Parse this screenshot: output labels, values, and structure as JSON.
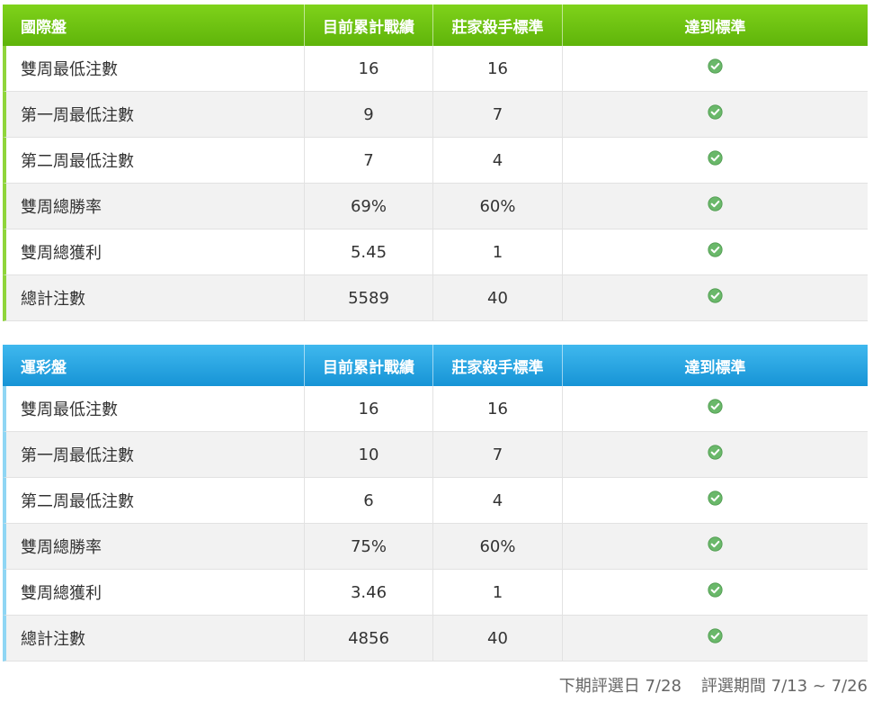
{
  "colors": {
    "intl_header": "#6cc412",
    "lottery_header": "#23a3e2",
    "check": "#5cb85c"
  },
  "tables": [
    {
      "title": "國際盤",
      "headers": [
        "目前累計戰績",
        "莊家殺手標準",
        "達到標準"
      ],
      "rows": [
        {
          "label": "雙周最低注數",
          "current": "16",
          "standard": "16",
          "status": "check-icon"
        },
        {
          "label": "第一周最低注數",
          "current": "9",
          "standard": "7",
          "status": "check-icon"
        },
        {
          "label": "第二周最低注數",
          "current": "7",
          "standard": "4",
          "status": "check-icon"
        },
        {
          "label": "雙周總勝率",
          "current": "69%",
          "standard": "60%",
          "status": "check-icon"
        },
        {
          "label": "雙周總獲利",
          "current": "5.45",
          "standard": "1",
          "status": "check-icon"
        },
        {
          "label": "總計注數",
          "current": "5589",
          "standard": "40",
          "status": "check-icon"
        }
      ]
    },
    {
      "title": "運彩盤",
      "headers": [
        "目前累計戰績",
        "莊家殺手標準",
        "達到標準"
      ],
      "rows": [
        {
          "label": "雙周最低注數",
          "current": "16",
          "standard": "16",
          "status": "check-icon"
        },
        {
          "label": "第一周最低注數",
          "current": "10",
          "standard": "7",
          "status": "check-icon"
        },
        {
          "label": "第二周最低注數",
          "current": "6",
          "standard": "4",
          "status": "check-icon"
        },
        {
          "label": "雙周總勝率",
          "current": "75%",
          "standard": "60%",
          "status": "check-icon"
        },
        {
          "label": "雙周總獲利",
          "current": "3.46",
          "standard": "1",
          "status": "check-icon"
        },
        {
          "label": "總計注數",
          "current": "4856",
          "standard": "40",
          "status": "check-icon"
        }
      ]
    }
  ],
  "footer": {
    "next_selection": "下期評選日 7/28",
    "selection_period": "評選期間 7/13 ~ 7/26"
  }
}
